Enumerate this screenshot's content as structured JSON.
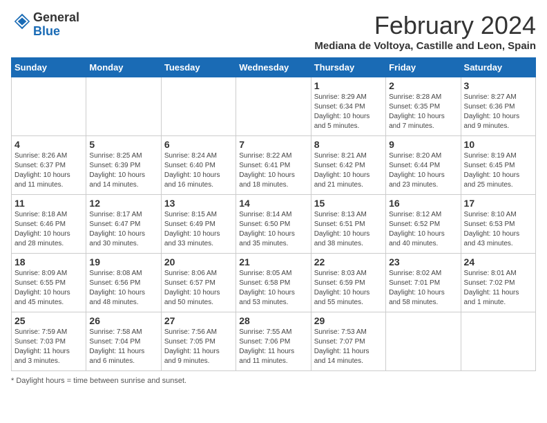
{
  "header": {
    "logo_general": "General",
    "logo_blue": "Blue",
    "month_title": "February 2024",
    "location": "Mediana de Voltoya, Castille and Leon, Spain"
  },
  "weekdays": [
    "Sunday",
    "Monday",
    "Tuesday",
    "Wednesday",
    "Thursday",
    "Friday",
    "Saturday"
  ],
  "weeks": [
    [
      {
        "day": "",
        "info": ""
      },
      {
        "day": "",
        "info": ""
      },
      {
        "day": "",
        "info": ""
      },
      {
        "day": "",
        "info": ""
      },
      {
        "day": "1",
        "info": "Sunrise: 8:29 AM\nSunset: 6:34 PM\nDaylight: 10 hours\nand 5 minutes."
      },
      {
        "day": "2",
        "info": "Sunrise: 8:28 AM\nSunset: 6:35 PM\nDaylight: 10 hours\nand 7 minutes."
      },
      {
        "day": "3",
        "info": "Sunrise: 8:27 AM\nSunset: 6:36 PM\nDaylight: 10 hours\nand 9 minutes."
      }
    ],
    [
      {
        "day": "4",
        "info": "Sunrise: 8:26 AM\nSunset: 6:37 PM\nDaylight: 10 hours\nand 11 minutes."
      },
      {
        "day": "5",
        "info": "Sunrise: 8:25 AM\nSunset: 6:39 PM\nDaylight: 10 hours\nand 14 minutes."
      },
      {
        "day": "6",
        "info": "Sunrise: 8:24 AM\nSunset: 6:40 PM\nDaylight: 10 hours\nand 16 minutes."
      },
      {
        "day": "7",
        "info": "Sunrise: 8:22 AM\nSunset: 6:41 PM\nDaylight: 10 hours\nand 18 minutes."
      },
      {
        "day": "8",
        "info": "Sunrise: 8:21 AM\nSunset: 6:42 PM\nDaylight: 10 hours\nand 21 minutes."
      },
      {
        "day": "9",
        "info": "Sunrise: 8:20 AM\nSunset: 6:44 PM\nDaylight: 10 hours\nand 23 minutes."
      },
      {
        "day": "10",
        "info": "Sunrise: 8:19 AM\nSunset: 6:45 PM\nDaylight: 10 hours\nand 25 minutes."
      }
    ],
    [
      {
        "day": "11",
        "info": "Sunrise: 8:18 AM\nSunset: 6:46 PM\nDaylight: 10 hours\nand 28 minutes."
      },
      {
        "day": "12",
        "info": "Sunrise: 8:17 AM\nSunset: 6:47 PM\nDaylight: 10 hours\nand 30 minutes."
      },
      {
        "day": "13",
        "info": "Sunrise: 8:15 AM\nSunset: 6:49 PM\nDaylight: 10 hours\nand 33 minutes."
      },
      {
        "day": "14",
        "info": "Sunrise: 8:14 AM\nSunset: 6:50 PM\nDaylight: 10 hours\nand 35 minutes."
      },
      {
        "day": "15",
        "info": "Sunrise: 8:13 AM\nSunset: 6:51 PM\nDaylight: 10 hours\nand 38 minutes."
      },
      {
        "day": "16",
        "info": "Sunrise: 8:12 AM\nSunset: 6:52 PM\nDaylight: 10 hours\nand 40 minutes."
      },
      {
        "day": "17",
        "info": "Sunrise: 8:10 AM\nSunset: 6:53 PM\nDaylight: 10 hours\nand 43 minutes."
      }
    ],
    [
      {
        "day": "18",
        "info": "Sunrise: 8:09 AM\nSunset: 6:55 PM\nDaylight: 10 hours\nand 45 minutes."
      },
      {
        "day": "19",
        "info": "Sunrise: 8:08 AM\nSunset: 6:56 PM\nDaylight: 10 hours\nand 48 minutes."
      },
      {
        "day": "20",
        "info": "Sunrise: 8:06 AM\nSunset: 6:57 PM\nDaylight: 10 hours\nand 50 minutes."
      },
      {
        "day": "21",
        "info": "Sunrise: 8:05 AM\nSunset: 6:58 PM\nDaylight: 10 hours\nand 53 minutes."
      },
      {
        "day": "22",
        "info": "Sunrise: 8:03 AM\nSunset: 6:59 PM\nDaylight: 10 hours\nand 55 minutes."
      },
      {
        "day": "23",
        "info": "Sunrise: 8:02 AM\nSunset: 7:01 PM\nDaylight: 10 hours\nand 58 minutes."
      },
      {
        "day": "24",
        "info": "Sunrise: 8:01 AM\nSunset: 7:02 PM\nDaylight: 11 hours\nand 1 minute."
      }
    ],
    [
      {
        "day": "25",
        "info": "Sunrise: 7:59 AM\nSunset: 7:03 PM\nDaylight: 11 hours\nand 3 minutes."
      },
      {
        "day": "26",
        "info": "Sunrise: 7:58 AM\nSunset: 7:04 PM\nDaylight: 11 hours\nand 6 minutes."
      },
      {
        "day": "27",
        "info": "Sunrise: 7:56 AM\nSunset: 7:05 PM\nDaylight: 11 hours\nand 9 minutes."
      },
      {
        "day": "28",
        "info": "Sunrise: 7:55 AM\nSunset: 7:06 PM\nDaylight: 11 hours\nand 11 minutes."
      },
      {
        "day": "29",
        "info": "Sunrise: 7:53 AM\nSunset: 7:07 PM\nDaylight: 11 hours\nand 14 minutes."
      },
      {
        "day": "",
        "info": ""
      },
      {
        "day": "",
        "info": ""
      }
    ]
  ],
  "footer": {
    "daylight_hours": "Daylight hours"
  }
}
